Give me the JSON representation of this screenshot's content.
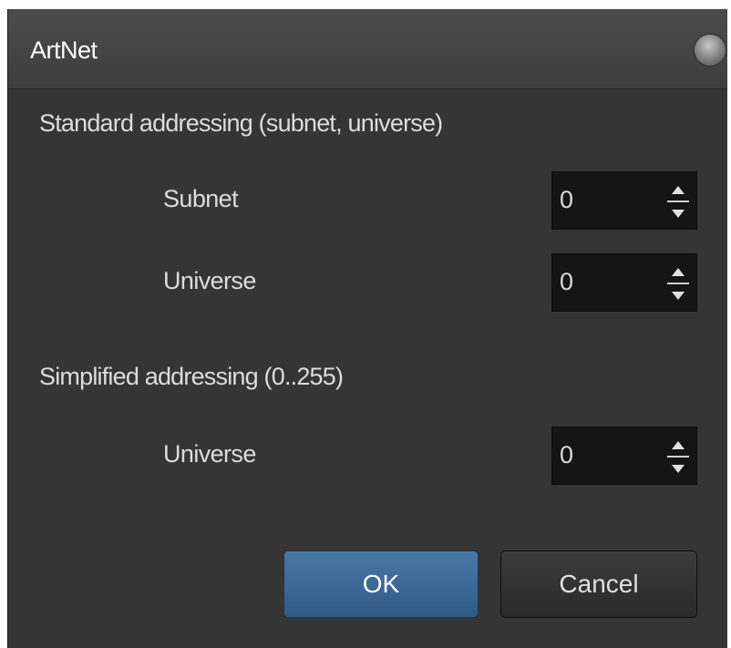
{
  "window": {
    "title": "ArtNet"
  },
  "standard": {
    "heading": "Standard addressing (subnet, universe)",
    "subnet_label": "Subnet",
    "subnet_value": "0",
    "universe_label": "Universe",
    "universe_value": "0"
  },
  "simplified": {
    "heading": "Simplified addressing (0..255)",
    "universe_label": "Universe",
    "universe_value": "0"
  },
  "buttons": {
    "ok": "OK",
    "cancel": "Cancel"
  },
  "colors": {
    "window_bg": "#353535",
    "field_bg": "#151515",
    "ok_accent": "#3a6794"
  },
  "icons": {
    "close": "close-icon",
    "spin_up": "spin-up-icon",
    "spin_down": "spin-down-icon"
  }
}
